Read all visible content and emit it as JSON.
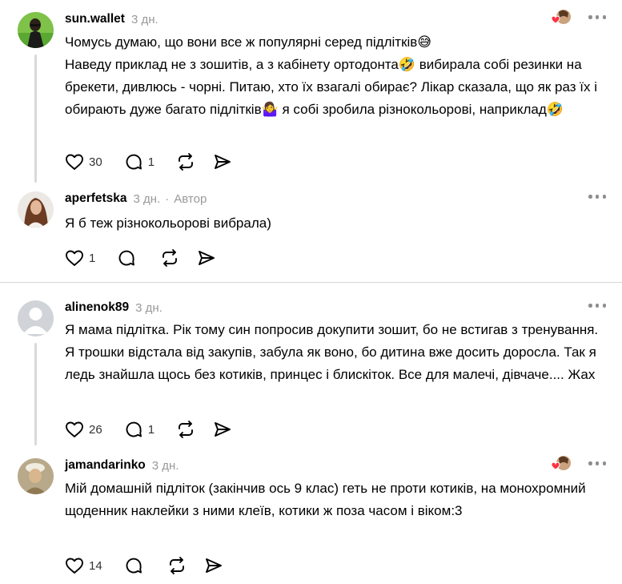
{
  "comments": [
    {
      "username": "sun.wallet",
      "time": "3 дн.",
      "text": "Чомусь думаю, що вони все ж популярні серед підлітків😅\nНаведу приклад не з зошитів, а з кабінету ортодонта🤣 вибирала собі резинки на брекети, дивлюсь - чорні. Питаю, хто їх взагалі обирає? Лікар сказала, що як раз їх і обирають дуже багато підлітків🤷‍♀️ я собі зробила різнокольорові, наприклад🤣",
      "likes": "30",
      "replies": "1"
    },
    {
      "username": "aperfetska",
      "time": "3 дн.",
      "author_badge": "Автор",
      "text": "Я б теж різнокольорові вибрала)",
      "likes": "1",
      "replies": ""
    },
    {
      "username": "alinenok89",
      "time": "3 дн.",
      "text": "Я мама підлітка. Рік тому син попросив докупити зошит, бо не встигав з тренування. Я трошки відстала від закупів, забула як воно, бо дитина вже досить доросла. Так я ледь знайшла щось без котиків, принцес і блискіток. Все для малечі, дівчаче.... Жах",
      "likes": "26",
      "replies": "1"
    },
    {
      "username": "jamandarinko",
      "time": "3 дн.",
      "text": "Мій домашній підліток (закінчив ось 9 клас) геть не проти котиків, на монохромний щоденник наклейки з ними клеїв, котики ж поза часом і віком:3",
      "likes": "14",
      "replies": ""
    }
  ],
  "colors": {
    "muted": "#999999",
    "heart_red": "#ff3040",
    "divider": "#d6d6d6"
  },
  "icons": [
    "heart-icon",
    "reply-icon",
    "repost-icon",
    "share-icon",
    "more-icon",
    "liked-by-author-icon"
  ]
}
